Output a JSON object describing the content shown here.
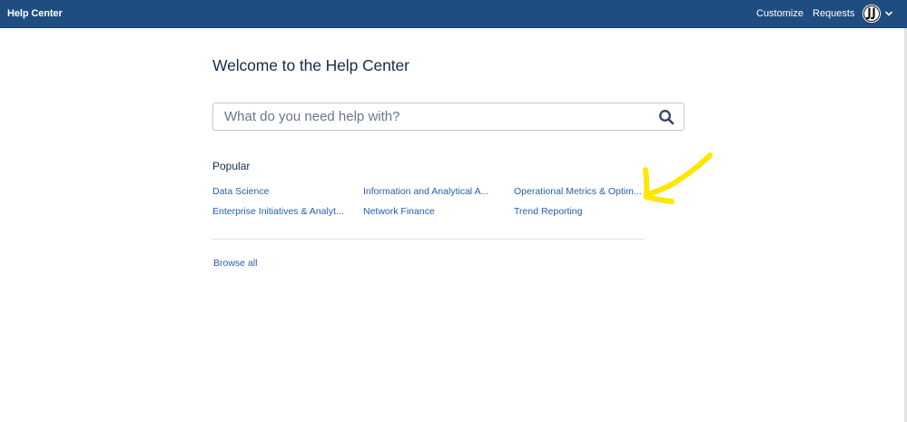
{
  "header": {
    "brand": "Help Center",
    "nav": {
      "customize": "Customize",
      "requests": "Requests"
    },
    "avatar_initials": "JJ"
  },
  "main": {
    "title": "Welcome to the Help Center",
    "search": {
      "placeholder": "What do you need help with?",
      "value": ""
    },
    "popular": {
      "heading": "Popular",
      "links": [
        "Data Science",
        "Information and Analytical A...",
        "Operational Metrics & Optim...",
        "Enterprise Initiatives & Analyt...",
        "Network Finance",
        "Trend Reporting"
      ]
    },
    "browse_all": "Browse all"
  },
  "colors": {
    "header_bg": "#1f4d82",
    "link": "#1f5fb0",
    "text": "#172b4d",
    "annotation": "#ffe600"
  },
  "icons": {
    "search": "search-icon",
    "chevron": "chevron-down-icon",
    "annotation": "arrow-annotation"
  }
}
